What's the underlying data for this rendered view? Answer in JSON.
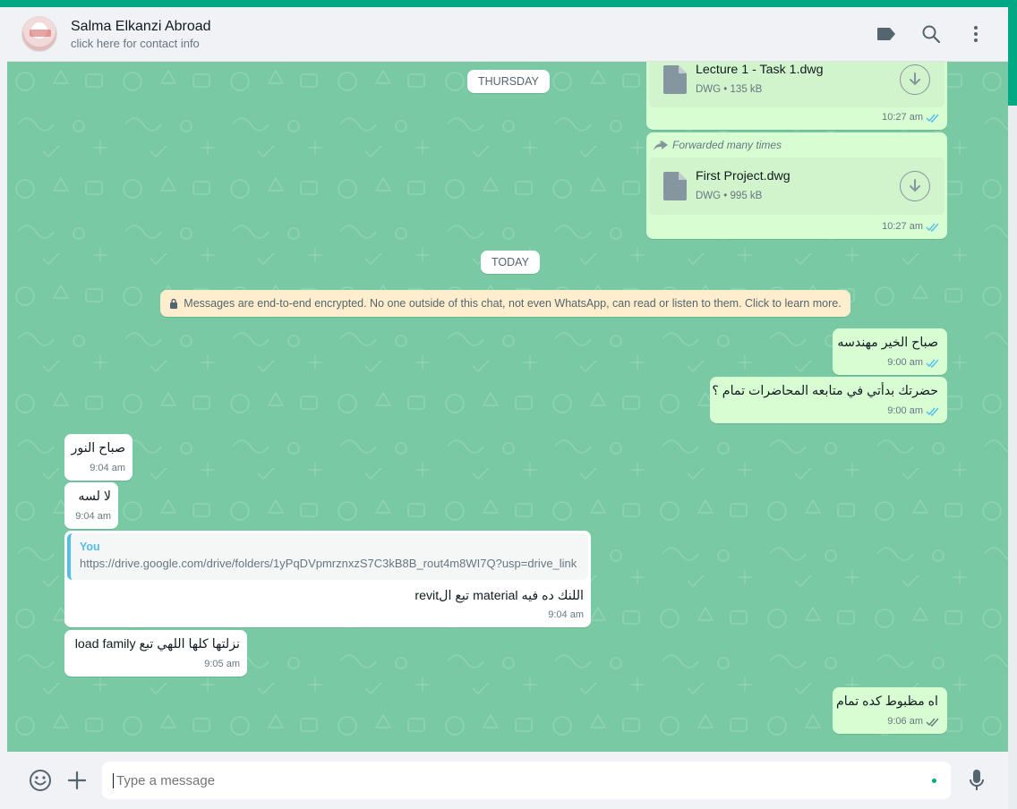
{
  "header": {
    "contact_name": "Salma Elkanzi Abroad",
    "contact_subtitle": "click here for contact info"
  },
  "dates": {
    "thursday": "THURSDAY",
    "today": "TODAY"
  },
  "encryption_notice": "Messages are end-to-end encrypted. No one outside of this chat, not even WhatsApp, can read or listen to them. Click to learn more.",
  "messages": [
    {
      "dir": "out",
      "kind": "document",
      "file_name": "Lecture 1 - Task 1.dwg",
      "file_type": "DWG",
      "file_size": "135 kB",
      "time": "10:27 am"
    },
    {
      "dir": "out",
      "kind": "document",
      "forwarded_label": "Forwarded many times",
      "file_name": "First Project.dwg",
      "file_type": "DWG",
      "file_size": "995 kB",
      "time": "10:27 am"
    },
    {
      "dir": "out",
      "kind": "text",
      "text": "صباح الخير مهندسه",
      "time": "9:00 am"
    },
    {
      "dir": "out",
      "kind": "text",
      "text": "حضرتك بدأتي في متابعه المحاضرات تمام ؟",
      "time": "9:00 am"
    },
    {
      "dir": "in",
      "kind": "text",
      "text": "صباح النور",
      "time": "9:04 am"
    },
    {
      "dir": "in",
      "kind": "text",
      "text": "لا لسه",
      "time": "9:04 am"
    },
    {
      "dir": "in",
      "kind": "reply",
      "quote_author": "You",
      "quote_text": "https://drive.google.com/drive/folders/1yPqDVpmrznxzS7C3kB8B_rout4m8WI7Q?usp=drive_link",
      "text": "اللنك ده فيه material تبع الrevit",
      "time": "9:04 am"
    },
    {
      "dir": "in",
      "kind": "text",
      "text": "نزلتها كلها  اللهي تبع load family",
      "time": "9:05 am"
    },
    {
      "dir": "out",
      "kind": "text",
      "text": "اه مظبوط كده تمام",
      "time": "9:06 am"
    }
  ],
  "composer": {
    "placeholder": "Type a message"
  },
  "icons": {
    "header": [
      "label-icon",
      "search-icon",
      "menu-icon"
    ],
    "footer": [
      "emoji-icon",
      "attach-plus-icon",
      "microphone-icon"
    ]
  },
  "colors": {
    "accent": "#00a884",
    "chat_background": "#7ac9a5",
    "outgoing_bubble": "#d9fdd3",
    "incoming_bubble": "#ffffff",
    "read_ticks": "#53bdeb",
    "encryption_banner": "#ffeecd"
  }
}
